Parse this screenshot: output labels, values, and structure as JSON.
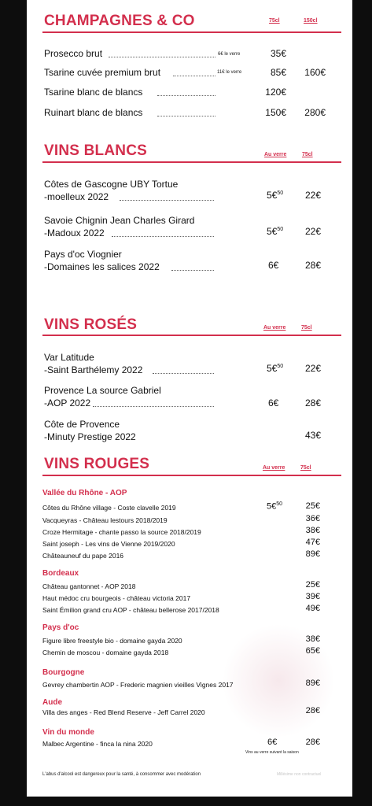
{
  "sections": {
    "champagnes": {
      "title": "CHAMPAGNES & CO",
      "col1": "75cl",
      "col2": "150cl"
    },
    "blancs": {
      "title": "VINS BLANCS",
      "col1": "Au verre",
      "col2": "75cl"
    },
    "roses": {
      "title": "VINS ROSÉS",
      "col1": "Au verre",
      "col2": "75cl"
    },
    "rouges": {
      "title": "VINS ROUGES",
      "col1": "Au verre",
      "col2": "75cl"
    }
  },
  "champagnes": [
    {
      "name": "Prosecco brut",
      "note": "6€ le verre",
      "p1": "35€",
      "p2": ""
    },
    {
      "name": "Tsarine cuvée premium brut",
      "note": "11€ le verre",
      "p1": "85€",
      "p2": "160€"
    },
    {
      "name": "Tsarine blanc de blancs",
      "note": "",
      "p1": "120€",
      "p2": ""
    },
    {
      "name": "Ruinart blanc de blancs",
      "note": "",
      "p1": "150€",
      "p2": "280€"
    }
  ],
  "blancs": [
    {
      "line1": "Côtes de Gascogne UBY Tortue",
      "line2": "-moelleux 2022",
      "glass": "5€",
      "glass_sup": "50",
      "bottle": "22€"
    },
    {
      "line1": "Savoie Chignin Jean Charles Girard",
      "line2": "-Madoux 2022",
      "glass": "5€",
      "glass_sup": "50",
      "bottle": "22€"
    },
    {
      "line1": "Pays d'oc Viognier",
      "line2": "-Domaines les salices 2022",
      "glass": "6€",
      "glass_sup": "",
      "bottle": "28€"
    }
  ],
  "roses": [
    {
      "line1": "Var Latitude",
      "line2": "-Saint Barthélemy 2022",
      "glass": "5€",
      "glass_sup": "50",
      "bottle": "22€"
    },
    {
      "line1": "Provence La source Gabriel",
      "line2": "-AOP 2022",
      "glass": "6€",
      "glass_sup": "",
      "bottle": "28€"
    },
    {
      "line1": "Côte de Provence",
      "line2": "-Minuty Prestige 2022",
      "glass": "",
      "glass_sup": "",
      "bottle": "43€"
    }
  ],
  "rouges": {
    "rhone": {
      "title": "Vallée du Rhône - AOP",
      "items": [
        {
          "name": "Côtes du Rhône village - Coste clavelle 2019",
          "glass": "5€",
          "glass_sup": "50",
          "bottle": "25€"
        },
        {
          "name": "Vacqueyras - Château lestours 2018/2019",
          "glass": "",
          "glass_sup": "",
          "bottle": "36€"
        },
        {
          "name": "Croze Hermitage - chante passo la source 2018/2019",
          "glass": "",
          "glass_sup": "",
          "bottle": "38€"
        },
        {
          "name": "Saint joseph - Les vins de Vienne 2019/2020",
          "glass": "",
          "glass_sup": "",
          "bottle": "47€"
        },
        {
          "name": "Châteauneuf du pape 2016",
          "glass": "",
          "glass_sup": "",
          "bottle": "89€"
        }
      ]
    },
    "bordeaux": {
      "title": "Bordeaux",
      "items": [
        {
          "name": "Château gantonnet - AOP 2018",
          "bottle": "25€"
        },
        {
          "name": "Haut médoc cru bourgeois - château victoria 2017",
          "bottle": "39€"
        },
        {
          "name": "Saint Émilion grand cru AOP - château bellerose 2017/2018",
          "bottle": "49€"
        }
      ]
    },
    "paysdoc": {
      "title": "Pays d'oc",
      "items": [
        {
          "name": "Figure libre freestyle bio - domaine gayda 2020",
          "bottle": "38€"
        },
        {
          "name": "Chemin de moscou - domaine gayda 2018",
          "bottle": "65€"
        }
      ]
    },
    "bourgogne": {
      "title": "Bourgogne",
      "items": [
        {
          "name": "Gevrey chambertin AOP - Frederic magnien vieilles Vignes 2017",
          "bottle": "89€"
        }
      ]
    },
    "aude": {
      "title": "Aude",
      "items": [
        {
          "name": "Villa des anges - Red Blend Reserve - Jeff Carrel 2020",
          "bottle": "28€"
        }
      ]
    },
    "monde": {
      "title": "Vin du monde",
      "items": [
        {
          "name": "Malbec Argentine - finca la nina 2020",
          "glass": "6€",
          "bottle": "28€"
        }
      ],
      "note": "Vins au verre suivant la saison"
    }
  },
  "footer": {
    "warning": "L'abus d'alcool est dangereux pour la santé, à consommer avec modération",
    "right": "Millésime non contractuel"
  }
}
